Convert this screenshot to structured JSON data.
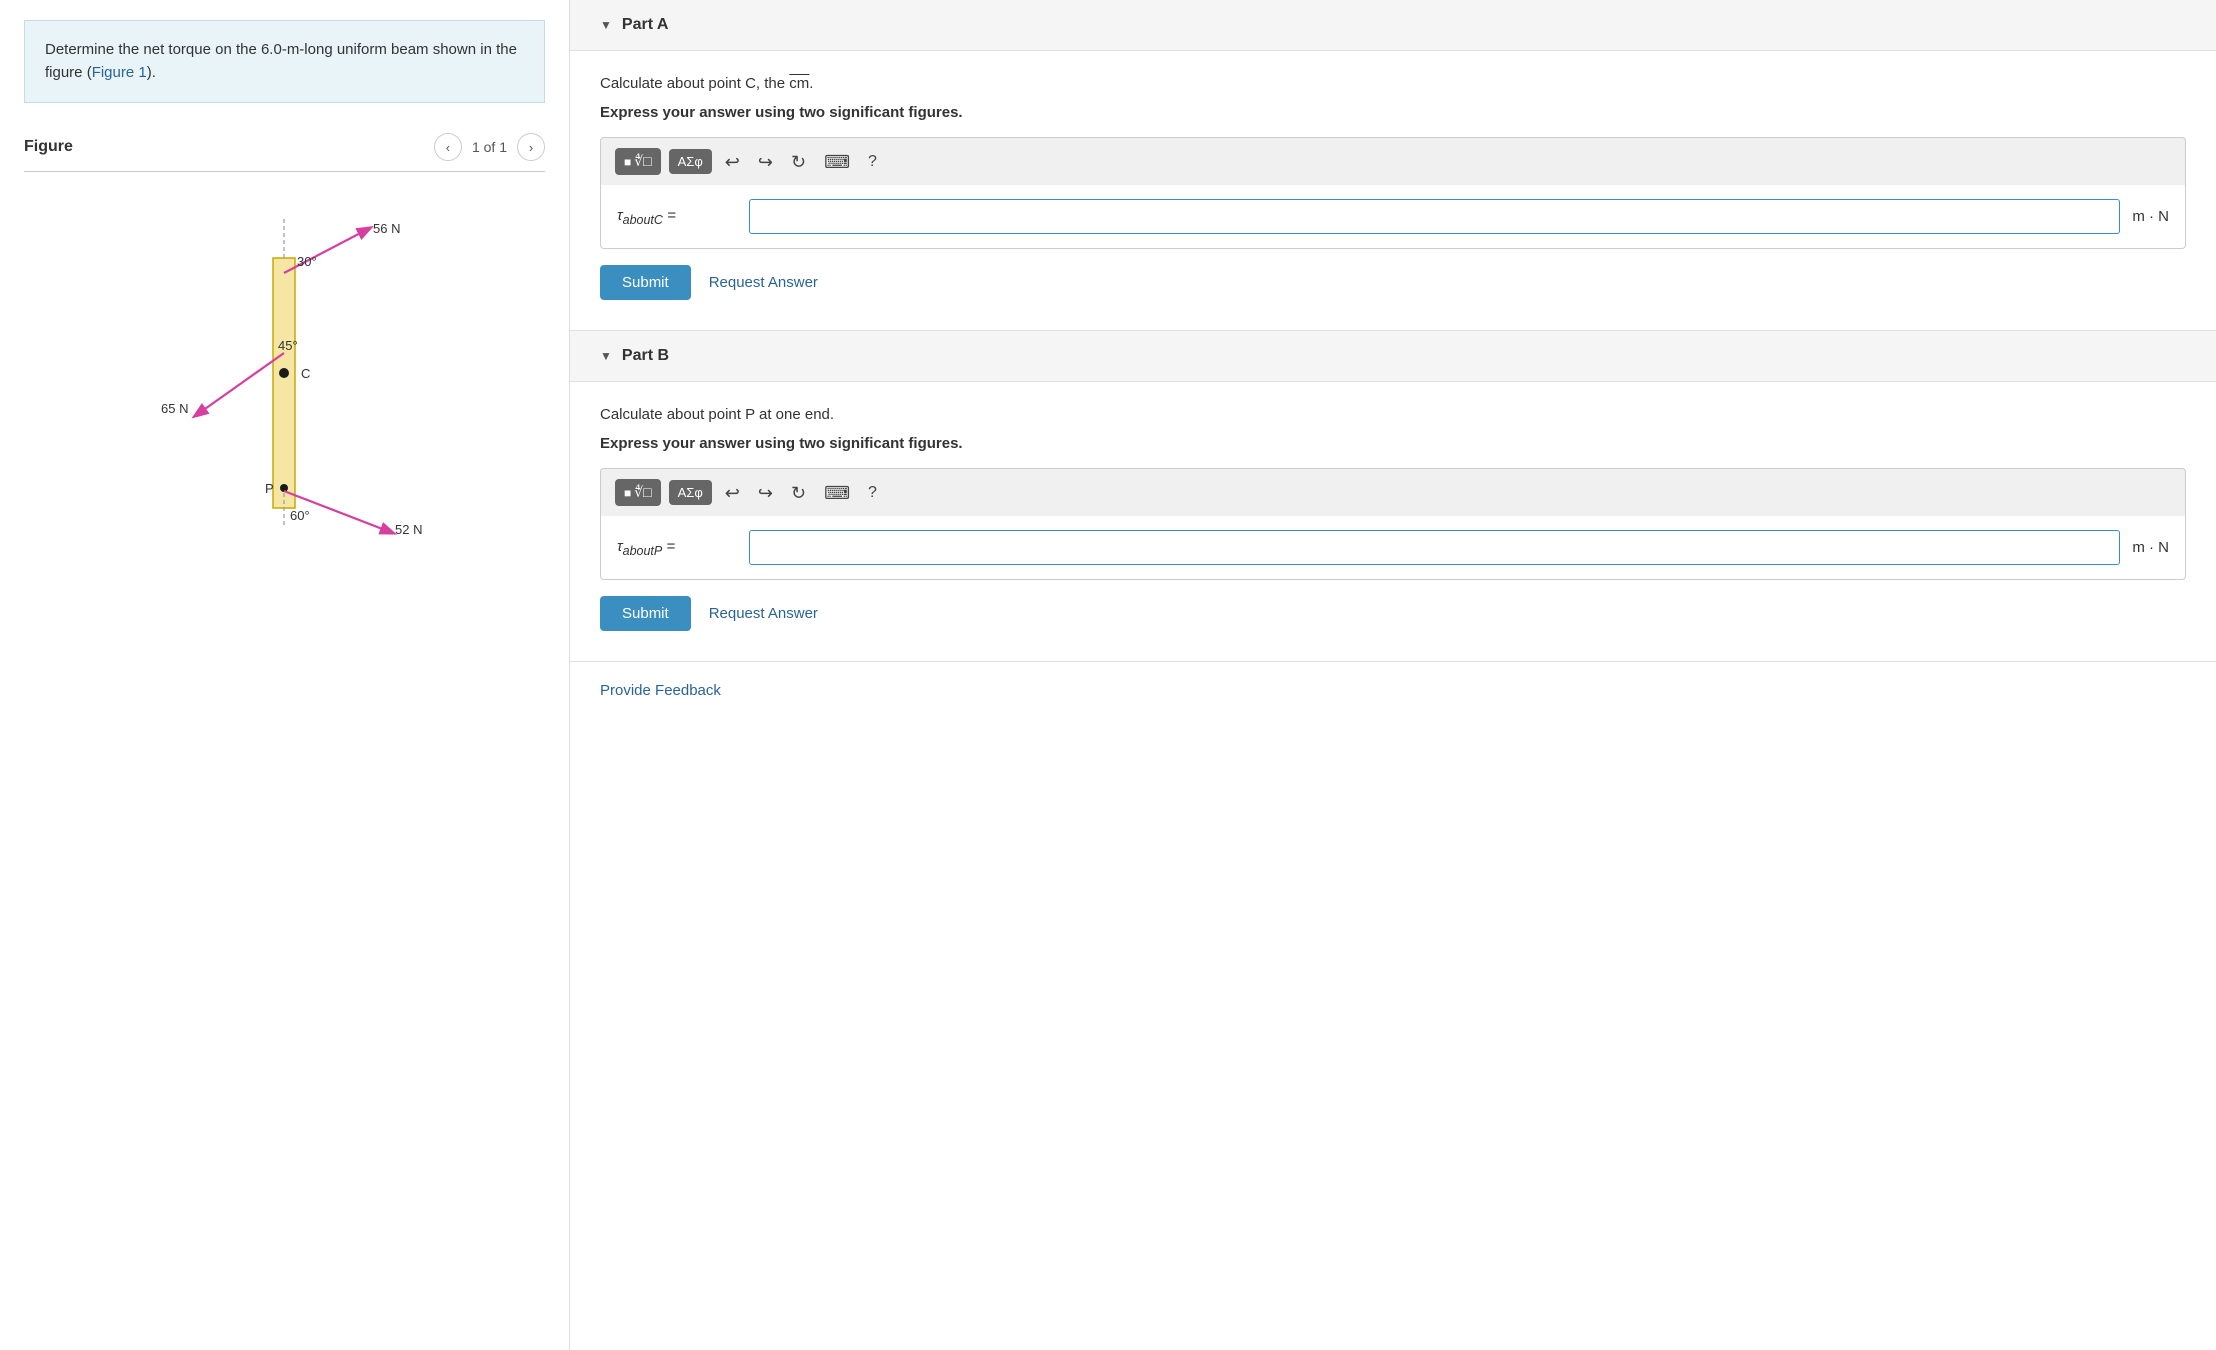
{
  "left": {
    "problem_text": "Determine the net torque on the 6.0-m-long uniform beam shown in the figure (",
    "figure_link_text": "Figure 1",
    "problem_text_end": ").",
    "figure_title": "Figure",
    "page_indicator": "1 of 1",
    "nav_prev_label": "‹",
    "nav_next_label": "›"
  },
  "right": {
    "parts": [
      {
        "id": "partA",
        "title": "Part A",
        "instruction": "Calculate about point C, the cm.",
        "express": "Express your answer using two significant figures.",
        "formula_label": "τaboutC =",
        "unit": "m · N",
        "submit_label": "Submit",
        "request_label": "Request Answer",
        "input_placeholder": ""
      },
      {
        "id": "partB",
        "title": "Part B",
        "instruction": "Calculate about point P at one end.",
        "express": "Express your answer using two significant figures.",
        "formula_label": "τaboutP =",
        "unit": "m · N",
        "submit_label": "Submit",
        "request_label": "Request Answer",
        "input_placeholder": ""
      }
    ],
    "provide_feedback_label": "Provide Feedback"
  }
}
